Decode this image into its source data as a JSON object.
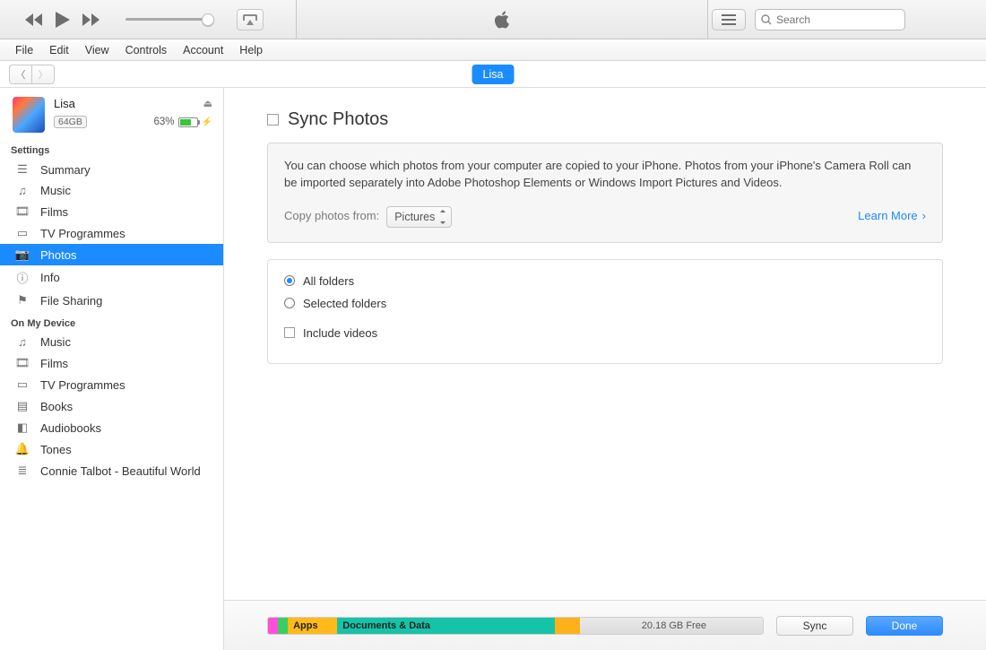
{
  "search": {
    "placeholder": "Search"
  },
  "menu": [
    "File",
    "Edit",
    "View",
    "Controls",
    "Account",
    "Help"
  ],
  "device_tab": "Lisa",
  "device": {
    "name": "Lisa",
    "capacity": "64GB",
    "battery_pct": "63%"
  },
  "sidebar": {
    "section_settings": "Settings",
    "settings_items": [
      {
        "label": "Summary"
      },
      {
        "label": "Music"
      },
      {
        "label": "Films"
      },
      {
        "label": "TV Programmes"
      },
      {
        "label": "Photos"
      },
      {
        "label": "Info"
      },
      {
        "label": "File Sharing"
      }
    ],
    "section_device": "On My Device",
    "device_items": [
      {
        "label": "Music"
      },
      {
        "label": "Films"
      },
      {
        "label": "TV Programmes"
      },
      {
        "label": "Books"
      },
      {
        "label": "Audiobooks"
      },
      {
        "label": "Tones"
      },
      {
        "label": "Connie Talbot - Beautiful World"
      }
    ]
  },
  "pane": {
    "title": "Sync Photos",
    "desc": "You can choose which photos from your computer are copied to your iPhone. Photos from your iPhone's Camera Roll can be imported separately into Adobe Photoshop Elements or Windows Import Pictures and Videos.",
    "copy_label": "Copy photos from:",
    "copy_source": "Pictures",
    "learn_more": "Learn More",
    "opt_all": "All folders",
    "opt_selected": "Selected folders",
    "opt_videos": "Include videos"
  },
  "storage": {
    "apps_label": "Apps",
    "docs_label": "Documents & Data",
    "free_label": "20.18 GB Free"
  },
  "footer": {
    "sync": "Sync",
    "done": "Done"
  }
}
